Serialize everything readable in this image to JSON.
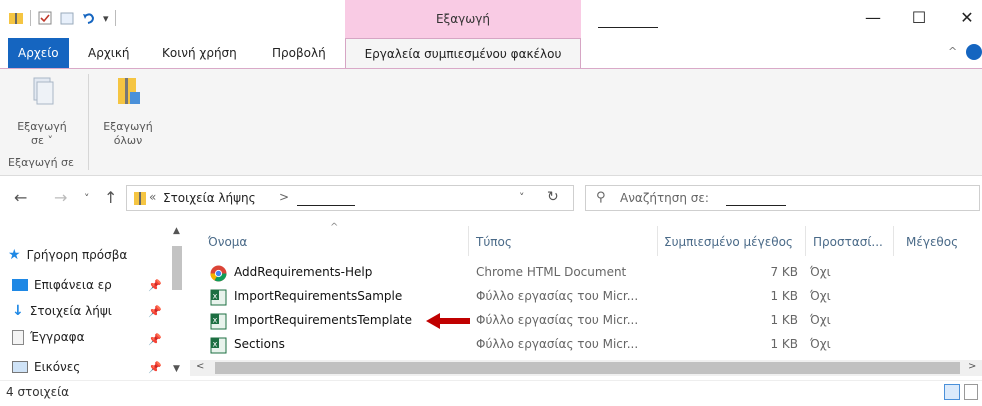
{
  "window": {
    "context_tab_title": "Εξαγωγή",
    "controls": {
      "minimize": "—",
      "maximize": "☐",
      "close": "✕"
    }
  },
  "ribbon_tabs": [
    {
      "label": "Αρχείο"
    },
    {
      "label": "Αρχική"
    },
    {
      "label": "Κοινή χρήση"
    },
    {
      "label": "Προβολή"
    },
    {
      "label": "Εργαλεία συμπιεσμένου φακέλου"
    }
  ],
  "ribbon": {
    "extract_to_label": "Εξαγωγή",
    "extract_to_sub": "σε ˅",
    "extract_all_label": "Εξαγωγή",
    "extract_all_sub": "όλων",
    "group_label": "Εξαγωγή σε"
  },
  "address": {
    "prefix": "«",
    "crumb": "Στοιχεία λήψης",
    "separator": ">",
    "search_placeholder": "Αναζήτηση σε:"
  },
  "nav_pane": {
    "items": [
      {
        "label": "Γρήγορη πρόσβα",
        "icon": "star-icon"
      },
      {
        "label": "Επιφάνεια ερ",
        "icon": "desktop-icon"
      },
      {
        "label": "Στοιχεία λήψι",
        "icon": "download-icon"
      },
      {
        "label": "Έγγραφα",
        "icon": "documents-icon"
      },
      {
        "label": "Εικόνες",
        "icon": "pictures-icon"
      }
    ]
  },
  "columns": {
    "name": "Όνομα",
    "type": "Τύπος",
    "compressed_size": "Συμπιεσμένο μέγεθος",
    "protected": "Προστασί...",
    "size": "Μέγεθος"
  },
  "files": [
    {
      "name": "AddRequirements-Help",
      "type": "Chrome HTML Document",
      "size": "7 KB",
      "protected": "Όχι",
      "icon": "chrome-icon"
    },
    {
      "name": "ImportRequirementsSample",
      "type": "Φύλλο εργασίας του Micr...",
      "size": "1 KB",
      "protected": "Όχι",
      "icon": "excel-icon"
    },
    {
      "name": "ImportRequirementsTemplate",
      "type": "Φύλλο εργασίας του Micr...",
      "size": "1 KB",
      "protected": "Όχι",
      "icon": "excel-icon"
    },
    {
      "name": "Sections",
      "type": "Φύλλο εργασίας του Micr...",
      "size": "1 KB",
      "protected": "Όχι",
      "icon": "excel-icon"
    }
  ],
  "status": {
    "count": "4 στοιχεία"
  },
  "colors": {
    "accent": "#1565c0",
    "context_tab": "#f9cbe4",
    "arrow": "#c00000"
  }
}
